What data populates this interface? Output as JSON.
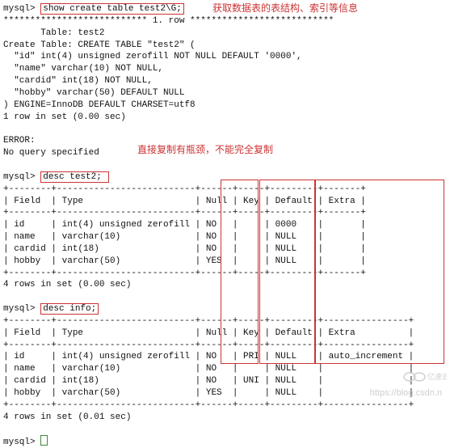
{
  "anno": {
    "top": "获取数据表的表结构、索引等信息",
    "mid": "直接复制有瓶颈，不能完全复制"
  },
  "terminal": {
    "prompt": "mysql>",
    "cmd1": "show create table test2\\G;",
    "row_sep": "*************************** 1. row ***************************",
    "create_block": {
      "l1": "       Table: test2",
      "l2": "Create Table: CREATE TABLE \"test2\" (",
      "l3": "  \"id\" int(4) unsigned zerofill NOT NULL DEFAULT '0000',",
      "l4": "  \"name\" varchar(10) NOT NULL,",
      "l5": "  \"cardid\" int(18) NOT NULL,",
      "l6": "  \"hobby\" varchar(50) DEFAULT NULL",
      "l7": ") ENGINE=InnoDB DEFAULT CHARSET=utf8",
      "l8": "1 row in set (0.00 sec)"
    },
    "err1": "ERROR:",
    "err2": "No query specified",
    "cmd2": "desc test2;",
    "table1": {
      "hr": "+--------+--------------------------+------+-----+---------+-------+",
      "hdr": "| Field  | Type                     | Null | Key | Default | Extra |",
      "r1": "| id     | int(4) unsigned zerofill | NO   |     | 0000    |       |",
      "r2": "| name   | varchar(10)              | NO   |     | NULL    |       |",
      "r3": "| cardid | int(18)                  | NO   |     | NULL    |       |",
      "r4": "| hobby  | varchar(50)              | YES  |     | NULL    |       |",
      "foot": "4 rows in set (0.00 sec)"
    },
    "cmd3": "desc info;",
    "table2": {
      "hr": "+--------+--------------------------+------+-----+---------+----------------+",
      "hdr": "| Field  | Type                     | Null | Key | Default | Extra          |",
      "r1": "| id     | int(4) unsigned zerofill | NO   | PRI | NULL    | auto_increment |",
      "r2": "| name   | varchar(10)              | NO   |     | NULL    |                |",
      "r3": "| cardid | int(18)                  | NO   | UNI | NULL    |                |",
      "r4": "| hobby  | varchar(50)              | YES  |     | NULL    |                |",
      "foot": "4 rows in set (0.01 sec)"
    }
  },
  "watermark": {
    "url": "https://blog.csdn.n",
    "brand": "亿速云"
  }
}
